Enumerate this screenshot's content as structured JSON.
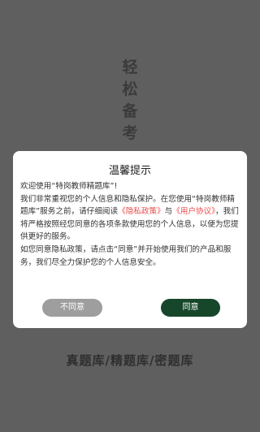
{
  "splash": {
    "vertical_chars": [
      "轻",
      "松",
      "备",
      "考"
    ],
    "bottom_text": "真题库/精题库/密题库"
  },
  "dialog": {
    "title": "温馨提示",
    "welcome": "欢迎使用“特岗教师精题库”!",
    "para1_a": "我们非常重视您的个人信息和隐私保护。在您使用“特岗教师精题库”服务之前，请仔细阅读",
    "privacy_link": "《隐私政策》",
    "para1_b": "与",
    "user_agreement_link": "《用户协议》",
    "para1_c": "，我们将严格按照经您同意的各项条款使用您的个人信息，以便为您提供更好的服务。",
    "para2": "如您同意隐私政策，请点击“同意”并开始使用我们的产品和服务，我们尽全力保护您的个人信息安全。",
    "decline_label": "不同意",
    "agree_label": "同意"
  }
}
